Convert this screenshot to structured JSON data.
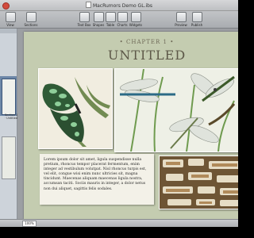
{
  "window": {
    "title": "MacRumors Demo GL.ibs"
  },
  "toolbar": {
    "items": [
      {
        "label": "View"
      },
      {
        "label": "Sections"
      },
      {
        "label": "Text Box"
      },
      {
        "label": "Shapes"
      },
      {
        "label": "Table"
      },
      {
        "label": "Charts"
      },
      {
        "label": "Widgets"
      },
      {
        "label": "Preview"
      },
      {
        "label": "Publish"
      }
    ]
  },
  "sidebar": {
    "section_label": "Section 1 · Untitled"
  },
  "page": {
    "chapter_label": "• CHAPTER 1 •",
    "chapter_title": "UNTITLED",
    "body_text": "Lorem ipsum dolor sit amet, ligula suspendisse nulla pretium, rhoncus tempor placerat fermentum, enim integer ad vestibulum volutpat. Nisl rhoncus turpis est, vel elit, congue wisi enim nunc ultricies sit, magna tincidunt. Maecenas aliquam maecenas ligula nostra, accumsan taciti. Sociis mauris in integer, a dolor netus non dui aliquet, sagittis felis sodales."
  },
  "statusbar": {
    "zoom": "100%"
  },
  "colors": {
    "page_bg": "#c4ccb0",
    "title": "#5d5848",
    "sidebar_selected": "#6d87a8"
  }
}
